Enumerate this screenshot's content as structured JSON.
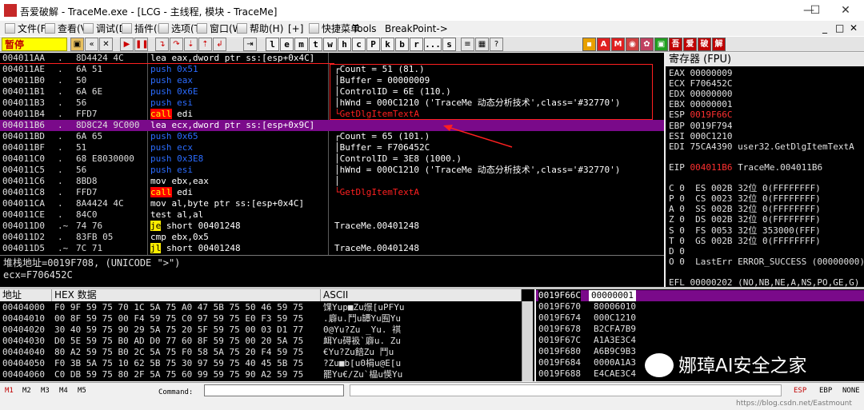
{
  "window": {
    "title": "吾爱破解 - TraceMe.exe - [LCG - 主线程, 模块 - TraceMe]",
    "icon_text": "吾爱",
    "minimize": "—",
    "maximize": "☐",
    "close": "✕"
  },
  "menu": [
    {
      "label": "文件(F)"
    },
    {
      "label": "查看(V)"
    },
    {
      "label": "调试(D)"
    },
    {
      "label": "插件(P)"
    },
    {
      "label": "选项(T)"
    },
    {
      "label": "窗口(W)"
    },
    {
      "label": "帮助(H)"
    },
    {
      "label": "[+]"
    },
    {
      "label": "快捷菜单"
    },
    {
      "label": "Tools"
    },
    {
      "label": "BreakPoint->"
    }
  ],
  "menu_right": [
    "_",
    "□",
    "✕"
  ],
  "toolbar": {
    "status": "暂停",
    "letters": [
      "l",
      "e",
      "m",
      "t",
      "w",
      "h",
      "c",
      "P",
      "k",
      "b",
      "r",
      "...",
      "s"
    ],
    "right_buttons": [
      "吾",
      "爱",
      "破",
      "解"
    ]
  },
  "disasm": [
    {
      "addr": "004011AA",
      "mark": ".",
      "hex": "8D4424 4C",
      "asm": [
        [
          "lea",
          "eax,dword ptr ss:[esp+0x4C]"
        ]
      ],
      "comment": ""
    },
    {
      "addr": "004011AE",
      "mark": ".",
      "hex": "6A 51",
      "asm": [
        [
          "push",
          "0x51"
        ]
      ],
      "comment": "┌Count = 51 (81.)"
    },
    {
      "addr": "004011B0",
      "mark": ".",
      "hex": "50",
      "asm": [
        [
          "push",
          "eax"
        ]
      ],
      "comment": "│Buffer = 00000009"
    },
    {
      "addr": "004011B1",
      "mark": ".",
      "hex": "6A 6E",
      "asm": [
        [
          "push",
          "0x6E"
        ]
      ],
      "comment": "│ControlID = 6E (110.)"
    },
    {
      "addr": "004011B3",
      "mark": ".",
      "hex": "56",
      "asm": [
        [
          "push",
          "esi"
        ]
      ],
      "comment": "│hWnd = 000C1210 ('TraceMe 动态分析技术',class='#32770')"
    },
    {
      "addr": "004011B4",
      "mark": ".",
      "hex": "FFD7",
      "asm": [
        [
          "call",
          "edi"
        ]
      ],
      "comment": "└GetDlgItemTextA",
      "comment_red": true
    },
    {
      "addr": "004011B6",
      "mark": ".",
      "hex": "8D8C24 9C000",
      "asm": [
        [
          "lea",
          "ecx,dword ptr ss:[esp+0x9C]"
        ]
      ],
      "comment": "",
      "selected": true
    },
    {
      "addr": "004011BD",
      "mark": ".",
      "hex": "6A 65",
      "asm": [
        [
          "push",
          "0x65"
        ]
      ],
      "comment": "┌Count = 65 (101.)"
    },
    {
      "addr": "004011BF",
      "mark": ".",
      "hex": "51",
      "asm": [
        [
          "push",
          "ecx"
        ]
      ],
      "comment": "│Buffer = F706452C"
    },
    {
      "addr": "004011C0",
      "mark": ".",
      "hex": "68 E8030000",
      "asm": [
        [
          "push",
          "0x3E8"
        ]
      ],
      "comment": "│ControlID = 3E8 (1000.)"
    },
    {
      "addr": "004011C5",
      "mark": ".",
      "hex": "56",
      "asm": [
        [
          "push",
          "esi"
        ]
      ],
      "comment": "│hWnd = 000C1210 ('TraceMe 动态分析技术',class='#32770')"
    },
    {
      "addr": "004011C6",
      "mark": ".",
      "hex": "8BD8",
      "asm": [
        [
          "mov",
          "ebx,eax"
        ]
      ],
      "comment": "│"
    },
    {
      "addr": "004011C8",
      "mark": ".",
      "hex": "FFD7",
      "asm": [
        [
          "call",
          "edi"
        ]
      ],
      "comment": "└GetDlgItemTextA",
      "comment_red": true
    },
    {
      "addr": "004011CA",
      "mark": ".",
      "hex": "8A4424 4C",
      "asm": [
        [
          "mov",
          "al,byte ptr ss:[esp+0x4C]"
        ]
      ],
      "comment": ""
    },
    {
      "addr": "004011CE",
      "mark": ".",
      "hex": "84C0",
      "asm": [
        [
          "test",
          "al,al"
        ]
      ],
      "comment": ""
    },
    {
      "addr": "004011D0",
      "mark": ".~",
      "hex": "74 76",
      "asm": [
        [
          "je",
          "short 00401248"
        ]
      ],
      "comment": "TraceMe.00401248"
    },
    {
      "addr": "004011D2",
      "mark": ".",
      "hex": "83FB 05",
      "asm": [
        [
          "cmp",
          "ebx,0x5"
        ]
      ],
      "comment": ""
    },
    {
      "addr": "004011D5",
      "mark": ".~",
      "hex": "7C 71",
      "asm": [
        [
          "jl",
          "short 00401248"
        ]
      ],
      "comment": "TraceMe.00401248"
    }
  ],
  "info": {
    "line1": "堆栈地址=0019F708, (UNICODE \">\")",
    "line2": "ecx=F706452C"
  },
  "registers": {
    "title": "寄存器 (FPU)",
    "lines": [
      {
        "text": "EAX 00000009"
      },
      {
        "text": "ECX F706452C"
      },
      {
        "text": "EDX 00000000"
      },
      {
        "text": "EBX 00000001"
      },
      {
        "text": "ESP ",
        "red": "0019F66C"
      },
      {
        "text": "EBP 0019F794"
      },
      {
        "text": "ESI 000C1210"
      },
      {
        "text": "EDI 75CA4390 user32.GetDlgItemTextA"
      },
      {
        "text": ""
      },
      {
        "text": "EIP ",
        "red": "004011B6",
        "tail": " TraceMe.004011B6"
      },
      {
        "text": ""
      },
      {
        "text": "C 0  ES 002B 32位 0(FFFFFFFF)"
      },
      {
        "text": "P 0  CS 0023 32位 0(FFFFFFFF)"
      },
      {
        "text": "A 0  SS 002B 32位 0(FFFFFFFF)"
      },
      {
        "text": "Z 0  DS 002B 32位 0(FFFFFFFF)"
      },
      {
        "text": "S 0  FS 0053 32位 353000(FFF)"
      },
      {
        "text": "T 0  GS 002B 32位 0(FFFFFFFF)"
      },
      {
        "text": "D 0"
      },
      {
        "text": "O 0  LastErr ERROR_SUCCESS (00000000)"
      },
      {
        "text": ""
      },
      {
        "text": "EFL 00000202 (NO,NB,NE,A,NS,PO,GE,G)"
      }
    ]
  },
  "dump": {
    "headers": [
      "地址",
      "HEX 数据",
      "ASCII"
    ],
    "rows": [
      {
        "addr": "00404000",
        "hex": "F0 9F 59 75 70 1C 5A 75 A0 47 5B 75 50 46 59 75",
        "ascii": "馃Yup■Zu燝[uPFYu"
      },
      {
        "addr": "00404010",
        "hex": "00 8F 59 75 00 F4 59 75 C0 97 59 75 E0 F3 59 75",
        "ascii": ".廦u.鬥u罈Yu囿Yu"
      },
      {
        "addr": "00404020",
        "hex": "30 40 59 75 90 29 5A 75 20 5F 59 75 00 03 D1 77",
        "ascii": "0@Yu?Zu _Yu. 祺"
      },
      {
        "addr": "00404030",
        "hex": "D0 5E 59 75 B0 AD D0 77 60 8F 59 75 00 20 5A 75",
        "ascii": "衈Yu碍衱`廦u. Zu"
      },
      {
        "addr": "00404040",
        "hex": "80 A2 59 75 B0 2C 5A 75 F0 58 5A 75 20 F4 59 75",
        "ascii": "€Yu?Zu餢Zu 鬥u"
      },
      {
        "addr": "00404050",
        "hex": "F0 3B 5A 75 10 62 5B 75 30 97 59 75 40 45 5B 75",
        "ascii": "?Zu■b[u0梋u@E[u"
      },
      {
        "addr": "00404060",
        "hex": "C0 DB 59 75 80 2F 5A 75 60 99 59 75 90 A2 59 75",
        "ascii": "罷Yu€/Zu`橸u愥Yu"
      }
    ]
  },
  "stack": {
    "rows": [
      {
        "addr": "0019F66C",
        "val": "00000001",
        "selected": true
      },
      {
        "addr": "0019F670",
        "val": "80006010"
      },
      {
        "addr": "0019F674",
        "val": "000C1210"
      },
      {
        "addr": "0019F678",
        "val": "B2CFA7B9"
      },
      {
        "addr": "0019F67C",
        "val": "A1A3E3C4"
      },
      {
        "addr": "0019F680",
        "val": "A6B9C9B3"
      },
      {
        "addr": "0019F684",
        "val": "0000A1A3"
      },
      {
        "addr": "0019F688",
        "val": "E4CAE3C4"
      }
    ]
  },
  "watermark": "娜璋AI安全之家",
  "statusbar": {
    "modes": [
      "M1",
      "M2",
      "M3",
      "M4",
      "M5"
    ],
    "command_label": "Command:",
    "regs": [
      "ESP",
      "EBP",
      "NONE"
    ]
  },
  "credit": "https://blog.csdn.net/Eastmount"
}
